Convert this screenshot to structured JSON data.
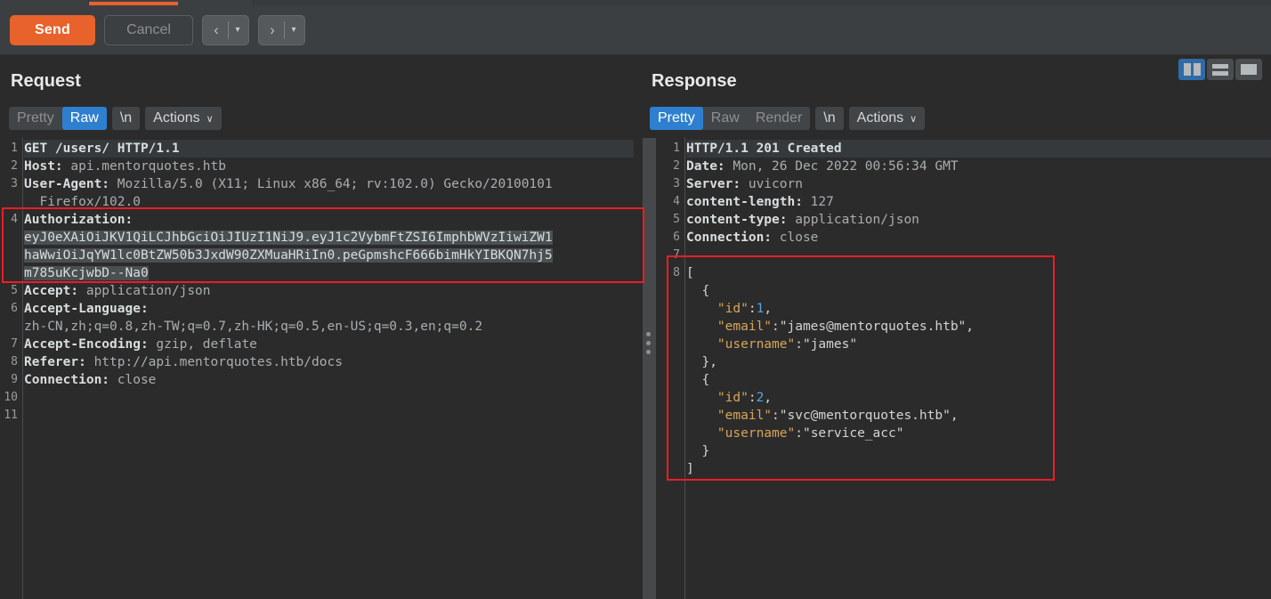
{
  "toolbar": {
    "send_label": "Send",
    "cancel_label": "Cancel",
    "back_glyph": "‹",
    "forward_glyph": "›",
    "caret_glyph": "▾"
  },
  "layout_toggle": {
    "split_vertical_active": true,
    "active_color": "#2f6ba8",
    "buttons": [
      "split-vertical",
      "split-horizontal",
      "single-pane"
    ]
  },
  "request": {
    "title": "Request",
    "tabs": [
      {
        "label": "Pretty",
        "selected": false
      },
      {
        "label": "Raw",
        "selected": true
      },
      {
        "label": "\\n",
        "selected": false
      }
    ],
    "actions_label": "Actions",
    "actions_caret": "∨",
    "line_numbers": [
      "1",
      "2",
      "3",
      "",
      "4",
      "",
      "",
      "",
      "5",
      "6",
      "",
      "7",
      "8",
      "9",
      "10",
      "11"
    ],
    "lines": [
      {
        "type": "plain",
        "highlight": true,
        "text": "GET /users/ HTTP/1.1"
      },
      {
        "type": "header",
        "name": "Host:",
        "value": " api.mentorquotes.htb"
      },
      {
        "type": "header",
        "name": "User-Agent:",
        "value": " Mozilla/5.0 (X11; Linux x86_64; rv:102.0) Gecko/20100101"
      },
      {
        "type": "cont",
        "text": "  Firefox/102.0"
      },
      {
        "type": "header",
        "name": "Authorization:",
        "value": ""
      },
      {
        "type": "selected",
        "text": "eyJ0eXAiOiJKV1QiLCJhbGciOiJIUzI1NiJ9.eyJ1c2VybmFtZSI6ImphbWVzIiwiZW1"
      },
      {
        "type": "selected",
        "text": "haWwiOiJqYW1lc0BtZW50b3JxdW90ZXMuaHRiIn0.peGpmshcF666bimHkYIBKQN7hj5"
      },
      {
        "type": "selected",
        "text": "m785uKcjwbD--Na0"
      },
      {
        "type": "header",
        "name": "Accept:",
        "value": " application/json"
      },
      {
        "type": "header",
        "name": "Accept-Language:",
        "value": ""
      },
      {
        "type": "cont",
        "text": "zh-CN,zh;q=0.8,zh-TW;q=0.7,zh-HK;q=0.5,en-US;q=0.3,en;q=0.2"
      },
      {
        "type": "header",
        "name": "Accept-Encoding:",
        "value": " gzip, deflate"
      },
      {
        "type": "header",
        "name": "Referer:",
        "value": " http://api.mentorquotes.htb/docs"
      },
      {
        "type": "header",
        "name": "Connection:",
        "value": " close"
      },
      {
        "type": "blank",
        "text": ""
      },
      {
        "type": "blank",
        "text": ""
      }
    ],
    "annotation_box": {
      "color": "#ee1c25",
      "covers": "authorization-header"
    }
  },
  "response": {
    "title": "Response",
    "tabs": [
      {
        "label": "Pretty",
        "selected": true
      },
      {
        "label": "Raw",
        "selected": false
      },
      {
        "label": "Render",
        "selected": false
      },
      {
        "label": "\\n",
        "selected": false
      }
    ],
    "actions_label": "Actions",
    "actions_caret": "∨",
    "line_numbers": [
      "1",
      "2",
      "3",
      "4",
      "5",
      "6",
      "7",
      "8"
    ],
    "status_line": "HTTP/1.1 201 Created",
    "headers": [
      {
        "name": "Date:",
        "value": " Mon, 26 Dec 2022 00:56:34 GMT"
      },
      {
        "name": "Server:",
        "value": " uvicorn"
      },
      {
        "name": "content-length:",
        "value": " 127"
      },
      {
        "name": "content-type:",
        "value": " application/json"
      },
      {
        "name": "Connection:",
        "value": " close"
      }
    ],
    "body_json": [
      {
        "indent": 0,
        "tokens": [
          {
            "t": "punc",
            "v": "["
          }
        ]
      },
      {
        "indent": 2,
        "tokens": [
          {
            "t": "punc",
            "v": "{"
          }
        ]
      },
      {
        "indent": 4,
        "tokens": [
          {
            "t": "key",
            "v": "\"id\""
          },
          {
            "t": "punc",
            "v": ":"
          },
          {
            "t": "num",
            "v": "1"
          },
          {
            "t": "punc",
            "v": ","
          }
        ]
      },
      {
        "indent": 4,
        "tokens": [
          {
            "t": "key",
            "v": "\"email\""
          },
          {
            "t": "punc",
            "v": ":"
          },
          {
            "t": "str",
            "v": "\"james@mentorquotes.htb\""
          },
          {
            "t": "punc",
            "v": ","
          }
        ]
      },
      {
        "indent": 4,
        "tokens": [
          {
            "t": "key",
            "v": "\"username\""
          },
          {
            "t": "punc",
            "v": ":"
          },
          {
            "t": "str",
            "v": "\"james\""
          }
        ]
      },
      {
        "indent": 2,
        "tokens": [
          {
            "t": "punc",
            "v": "},"
          }
        ]
      },
      {
        "indent": 2,
        "tokens": [
          {
            "t": "punc",
            "v": "{"
          }
        ]
      },
      {
        "indent": 4,
        "tokens": [
          {
            "t": "key",
            "v": "\"id\""
          },
          {
            "t": "punc",
            "v": ":"
          },
          {
            "t": "num",
            "v": "2"
          },
          {
            "t": "punc",
            "v": ","
          }
        ]
      },
      {
        "indent": 4,
        "tokens": [
          {
            "t": "key",
            "v": "\"email\""
          },
          {
            "t": "punc",
            "v": ":"
          },
          {
            "t": "str",
            "v": "\"svc@mentorquotes.htb\""
          },
          {
            "t": "punc",
            "v": ","
          }
        ]
      },
      {
        "indent": 4,
        "tokens": [
          {
            "t": "key",
            "v": "\"username\""
          },
          {
            "t": "punc",
            "v": ":"
          },
          {
            "t": "str",
            "v": "\"service_acc\""
          }
        ]
      },
      {
        "indent": 2,
        "tokens": [
          {
            "t": "punc",
            "v": "}"
          }
        ]
      },
      {
        "indent": 0,
        "tokens": [
          {
            "t": "punc",
            "v": "]"
          }
        ]
      }
    ],
    "annotation_box": {
      "color": "#ee1c25",
      "covers": "json-response-body"
    }
  }
}
